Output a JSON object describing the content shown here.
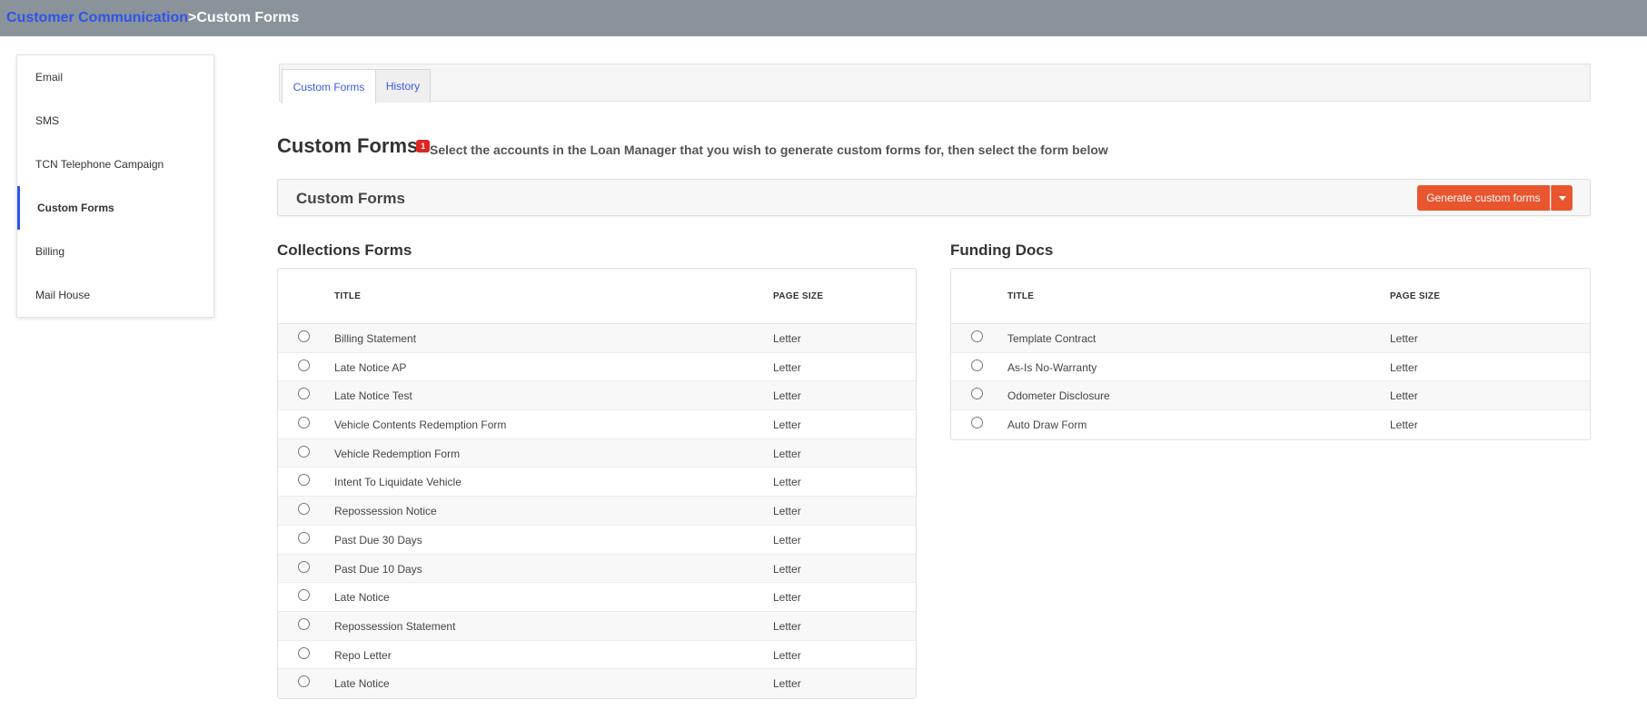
{
  "breadcrumb": {
    "parent": "Customer Communication",
    "separator": "> ",
    "current": "Custom Forms"
  },
  "sidebar": {
    "items": [
      {
        "label": "Email",
        "active": false
      },
      {
        "label": "SMS",
        "active": false
      },
      {
        "label": "TCN Telephone Campaign",
        "active": false
      },
      {
        "label": "Custom Forms",
        "active": true
      },
      {
        "label": "Billing",
        "active": false
      },
      {
        "label": "Mail House",
        "active": false
      }
    ]
  },
  "tabs": [
    {
      "label": "Custom Forms",
      "active": true
    },
    {
      "label": "History",
      "active": false
    }
  ],
  "heading": {
    "title": "Custom Forms",
    "badge": "1",
    "description": "Select the accounts in the Loan Manager that you wish to generate custom forms for, then select the form below"
  },
  "panel": {
    "title": "Custom Forms",
    "generate_label": "Generate custom forms"
  },
  "colors": {
    "accent": "#2f54eb",
    "button": "#e8552f",
    "badge": "#e02424",
    "topbar": "#8a9399"
  },
  "collections": {
    "title": "Collections Forms",
    "columns": {
      "title": "TITLE",
      "page_size": "PAGE SIZE"
    },
    "rows": [
      {
        "title": "Billing Statement",
        "page_size": "Letter"
      },
      {
        "title": "Late Notice AP",
        "page_size": "Letter"
      },
      {
        "title": "Late Notice Test",
        "page_size": "Letter"
      },
      {
        "title": "Vehicle Contents Redemption Form",
        "page_size": "Letter"
      },
      {
        "title": "Vehicle Redemption Form",
        "page_size": "Letter"
      },
      {
        "title": "Intent To Liquidate Vehicle",
        "page_size": "Letter"
      },
      {
        "title": "Repossession Notice",
        "page_size": "Letter"
      },
      {
        "title": "Past Due 30 Days",
        "page_size": "Letter"
      },
      {
        "title": "Past Due 10 Days",
        "page_size": "Letter"
      },
      {
        "title": "Late Notice",
        "page_size": "Letter"
      },
      {
        "title": "Repossession Statement",
        "page_size": "Letter"
      },
      {
        "title": "Repo Letter",
        "page_size": "Letter"
      },
      {
        "title": "Late Notice",
        "page_size": "Letter"
      }
    ]
  },
  "funding": {
    "title": "Funding Docs",
    "columns": {
      "title": "TITLE",
      "page_size": "PAGE SIZE"
    },
    "rows": [
      {
        "title": "Template Contract",
        "page_size": "Letter"
      },
      {
        "title": "As-Is No-Warranty",
        "page_size": "Letter"
      },
      {
        "title": "Odometer Disclosure",
        "page_size": "Letter"
      },
      {
        "title": "Auto Draw Form",
        "page_size": "Letter"
      }
    ]
  }
}
